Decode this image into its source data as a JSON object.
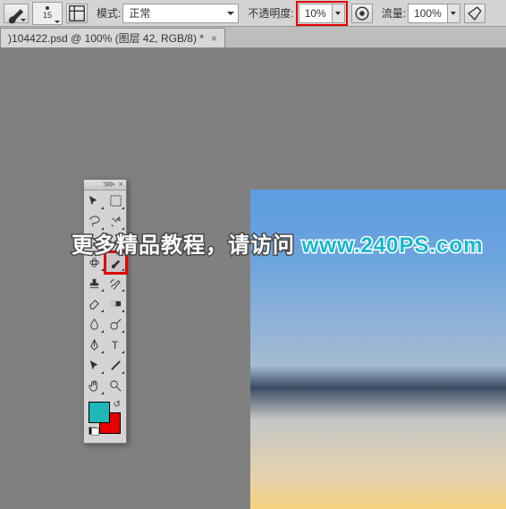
{
  "options_bar": {
    "brush_size": "15",
    "mode_label": "模式:",
    "mode_value": "正常",
    "opacity_label": "不透明度:",
    "opacity_value": "10%",
    "flow_label": "流量:",
    "flow_value": "100%"
  },
  "tab": {
    "title": ")104422.psd @ 100% (图层 42, RGB/8) *",
    "close": "×"
  },
  "panel": {
    "collapse": "⋙",
    "close": "×"
  },
  "swatches": {
    "fg": "#1fb7b7",
    "bg": "#e60000",
    "swap": "↺"
  },
  "overlay": {
    "text": "更多精品教程，请访问 ",
    "url": "www.240PS.com"
  },
  "icons": {
    "brush_tool": "brush",
    "panel_toggle": "panel",
    "pressure": "pressure",
    "airbrush": "airbrush"
  }
}
